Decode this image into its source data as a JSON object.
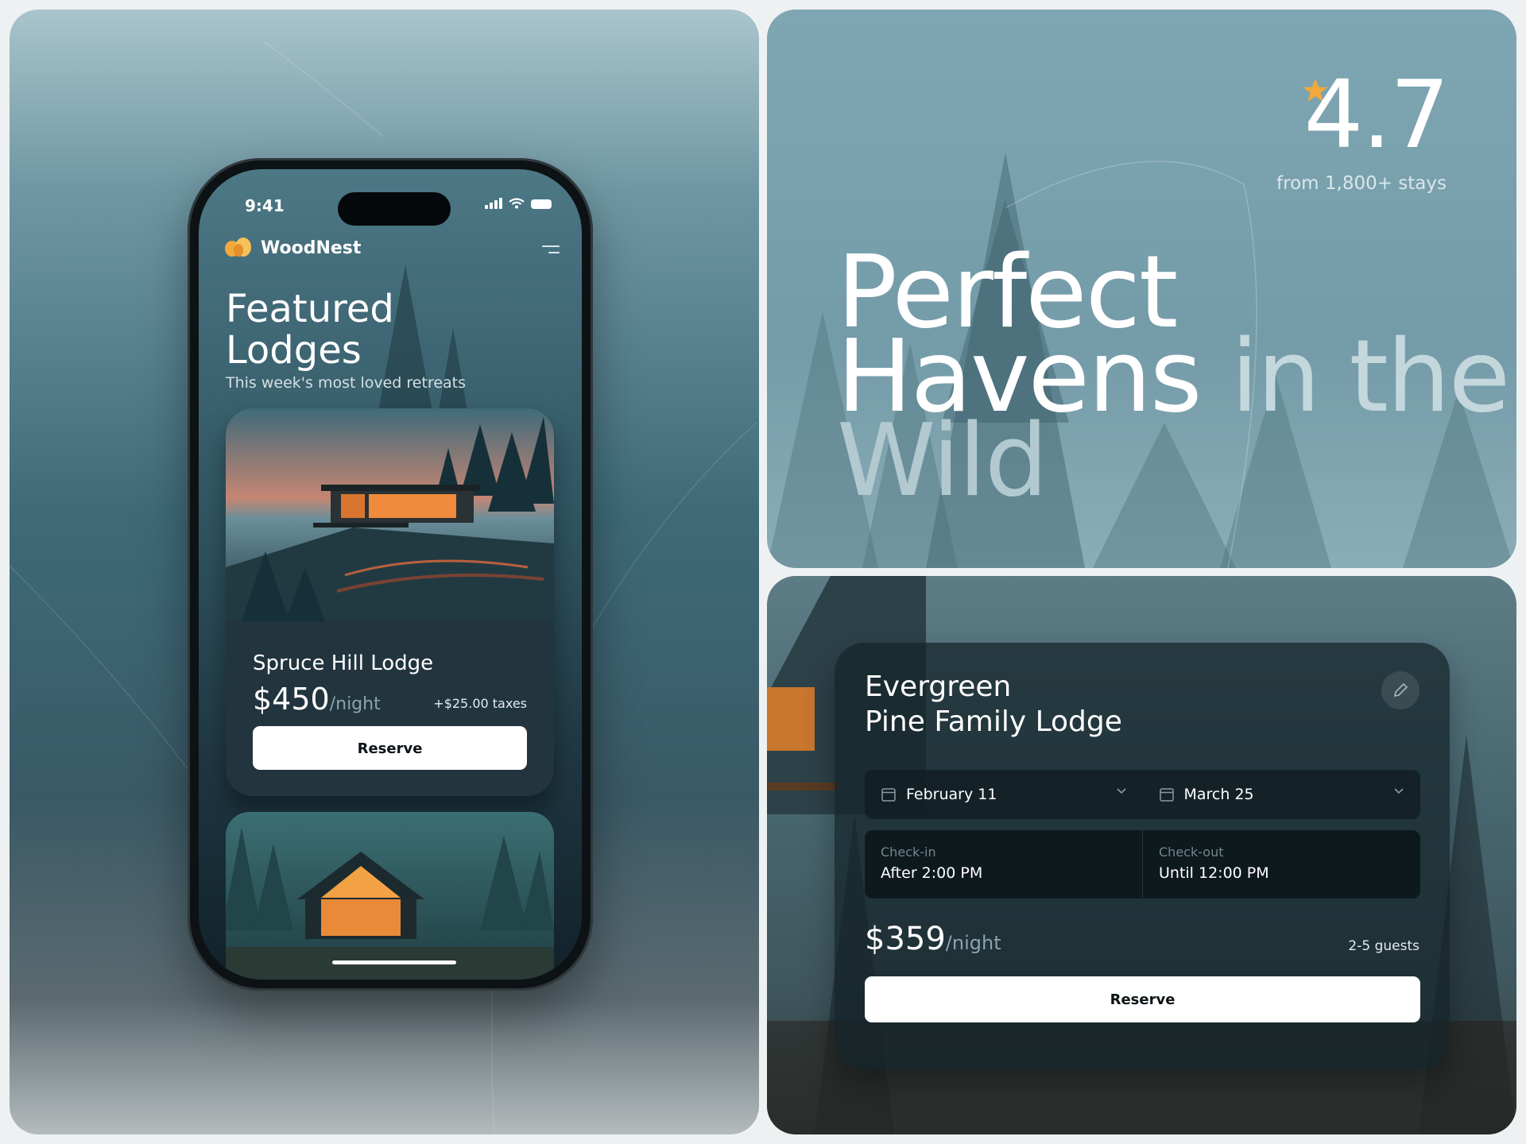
{
  "phone": {
    "status_time": "9:41",
    "brand_name": "WoodNest",
    "title_line1": "Featured",
    "title_line2": "Lodges",
    "subtitle": "This week's most loved retreats",
    "card": {
      "name": "Spruce Hill Lodge",
      "price": "$450",
      "unit": "/night",
      "taxes": "+$25.00 taxes",
      "button": "Reserve"
    }
  },
  "hero": {
    "rating": "4.7",
    "rating_sub": "from 1,800+ stays",
    "headline_1": "Perfect",
    "headline_2a": "Havens",
    "headline_2b": "in the",
    "headline_3": "Wild"
  },
  "booking": {
    "title_line1": "Evergreen",
    "title_line2": "Pine Family Lodge",
    "checkin_date": "February 11",
    "checkout_date": "March 25",
    "checkin_label": "Check-in",
    "checkin_value": "After 2:00 PM",
    "checkout_label": "Check-out",
    "checkout_value": "Until 12:00 PM",
    "price": "$359",
    "unit": "/night",
    "guests": "2-5 guests",
    "button": "Reserve"
  },
  "colors": {
    "accent_star": "#f2a93b",
    "button_bg": "#ffffff",
    "button_text": "#0d1417"
  },
  "icons": [
    "logo-icon",
    "menu-icon",
    "signal-icon",
    "wifi-icon",
    "battery-icon",
    "star-icon",
    "edit-icon",
    "calendar-icon",
    "chevron-down-icon"
  ]
}
